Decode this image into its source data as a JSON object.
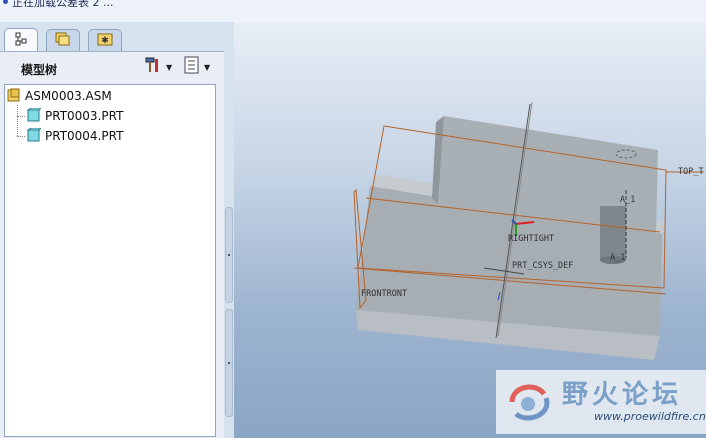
{
  "status": {
    "text": "正在加载公差表 2 ..."
  },
  "navigator": {
    "tabs": [
      {
        "name": "model-tree",
        "icon": "tree-structure-icon",
        "active": true
      },
      {
        "name": "folder-browser",
        "icon": "folders-icon",
        "active": false
      },
      {
        "name": "favorites",
        "icon": "star-folder-icon",
        "active": false
      }
    ],
    "title": "模型树",
    "tools_icon": "hammer-wrench-icon",
    "settings_icon": "list-settings-icon"
  },
  "tree": {
    "root": "ASM0003.ASM",
    "children": [
      "PRT0003.PRT",
      "PRT0004.PRT"
    ]
  },
  "viewport": {
    "labels": {
      "top": "TOP_T",
      "right": "RIGHTIGHT",
      "csys": "PRT_CSYS_DEF",
      "front": "FRONTRONT",
      "axis_a1_top": "A_1",
      "axis_a1_bottom": "A_1"
    }
  },
  "watermark": {
    "title": "野火论坛",
    "url": "www.proewildfire.cn"
  },
  "colors": {
    "datum_plane": "#b5632a",
    "model_face": "#a6aeb4",
    "accent_blue": "#2a4fb6"
  }
}
